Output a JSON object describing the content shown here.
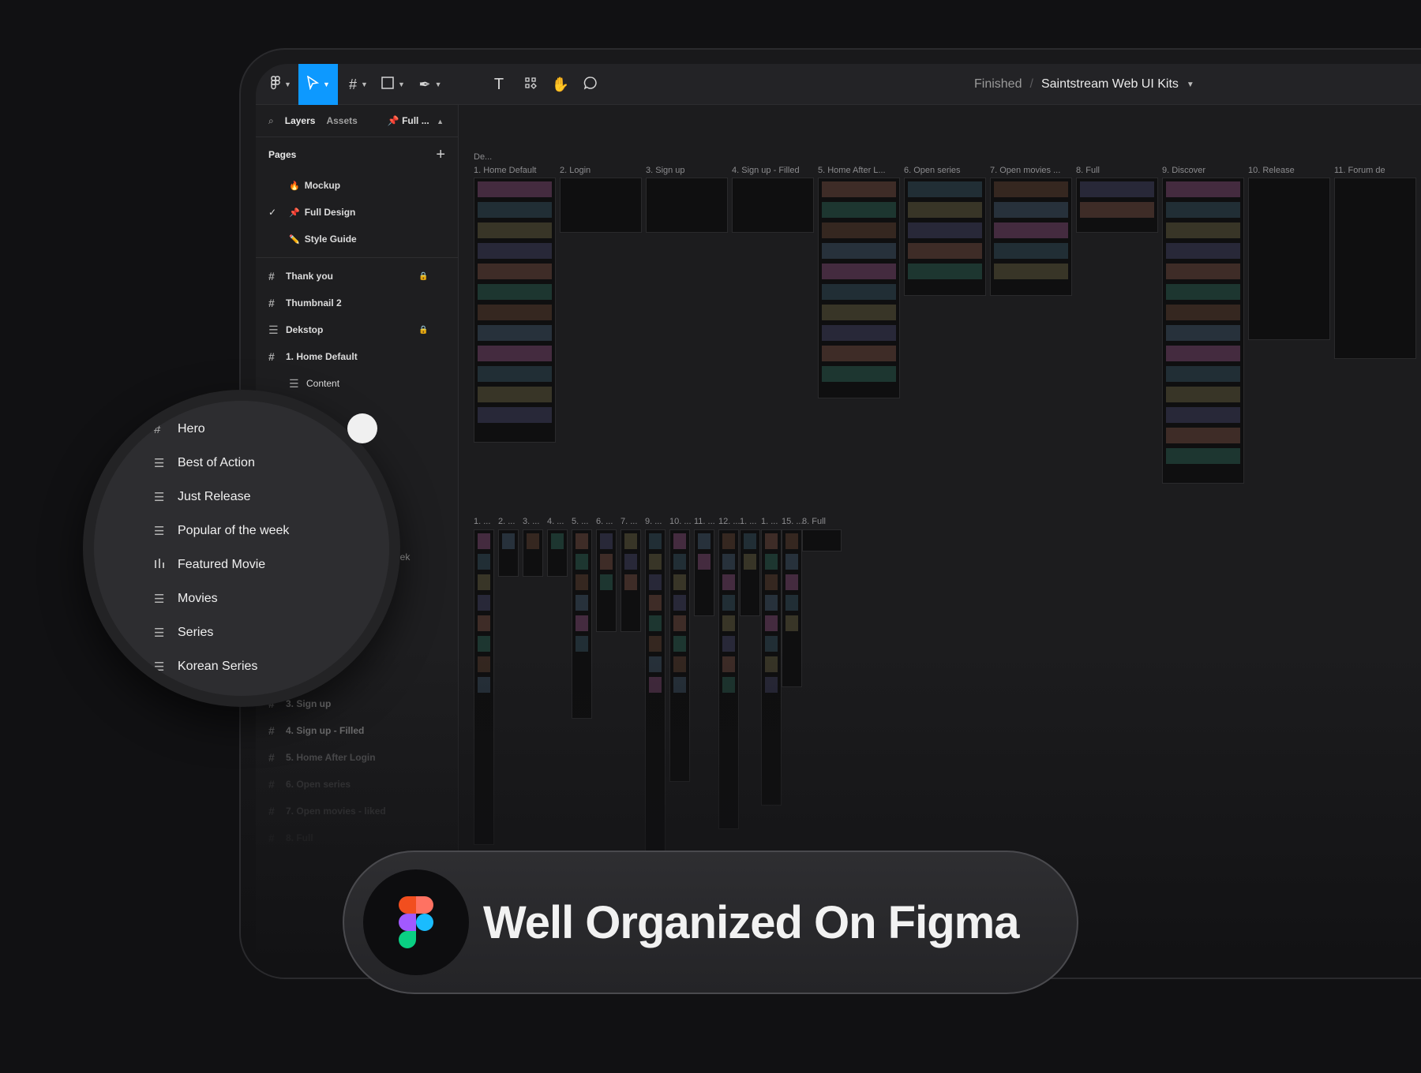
{
  "toolbar": {
    "text_tool": "T",
    "breadcrumb": {
      "folder": "Finished",
      "separator": "/",
      "file": "Saintstream Web UI Kits"
    }
  },
  "left_panel": {
    "tabs": {
      "layers": "Layers",
      "assets": "Assets",
      "page_selector": "Full ..."
    },
    "pages_header": "Pages",
    "pages": [
      {
        "emoji": "🔥",
        "label": "Mockup",
        "checked": false
      },
      {
        "emoji": "📌",
        "label": "Full Design",
        "checked": true
      },
      {
        "emoji": "✏️",
        "label": "Style Guide",
        "checked": false
      }
    ],
    "layers": [
      {
        "label": "Thank you",
        "icon": "frame-icon",
        "locked": true
      },
      {
        "label": "Thumbnail 2",
        "icon": "frame-icon",
        "locked": false
      },
      {
        "label": "Dekstop",
        "icon": "section-icon",
        "locked": true
      },
      {
        "label": "1. Home Default",
        "icon": "frame-icon",
        "locked": false
      },
      {
        "label": "Content",
        "icon": "section-icon",
        "locked": false
      }
    ],
    "lower_layers": [
      {
        "label": "3. Sign up"
      },
      {
        "label": "4. Sign up - Filled"
      },
      {
        "label": "5. Home After Login"
      },
      {
        "label": "6. Open series"
      },
      {
        "label": "7. Open movies - liked"
      },
      {
        "label": "8. Full"
      }
    ],
    "hidden_fragment": "eek"
  },
  "canvas": {
    "top_row_labels": [
      "De...",
      "1. Home Default",
      "2. Login",
      "3. Sign up",
      "4. Sign up - Filled",
      "5. Home After L...",
      "6. Open series",
      "7. Open movies ...",
      "8. Full",
      "9. Discover",
      "10. Release",
      "11. Forum de"
    ],
    "bottom_row_labels": [
      "1. ...",
      "2. ...",
      "3. ...",
      "4. ...",
      "5. ...",
      "6. ...",
      "7. ...",
      "9. ...",
      "10. ...",
      "11. ...",
      "12. ...",
      "1. ...",
      "1. ...",
      "15. ...",
      "8. Full"
    ]
  },
  "magnifier": {
    "items": [
      {
        "label": "Hero",
        "icon": "frame-icon"
      },
      {
        "label": "Best of Action",
        "icon": "section-icon"
      },
      {
        "label": "Just Release",
        "icon": "section-icon"
      },
      {
        "label": "Popular of the week",
        "icon": "section-icon"
      },
      {
        "label": "Featured Movie",
        "icon": "bars-icon"
      },
      {
        "label": "Movies",
        "icon": "section-icon"
      },
      {
        "label": "Series",
        "icon": "section-icon"
      },
      {
        "label": "Korean Series",
        "icon": "section-icon"
      }
    ]
  },
  "banner": {
    "text": "Well Organized On Figma"
  },
  "colors": {
    "accent": "#0d99ff",
    "background": "#111113",
    "panel": "#1e1e20"
  }
}
